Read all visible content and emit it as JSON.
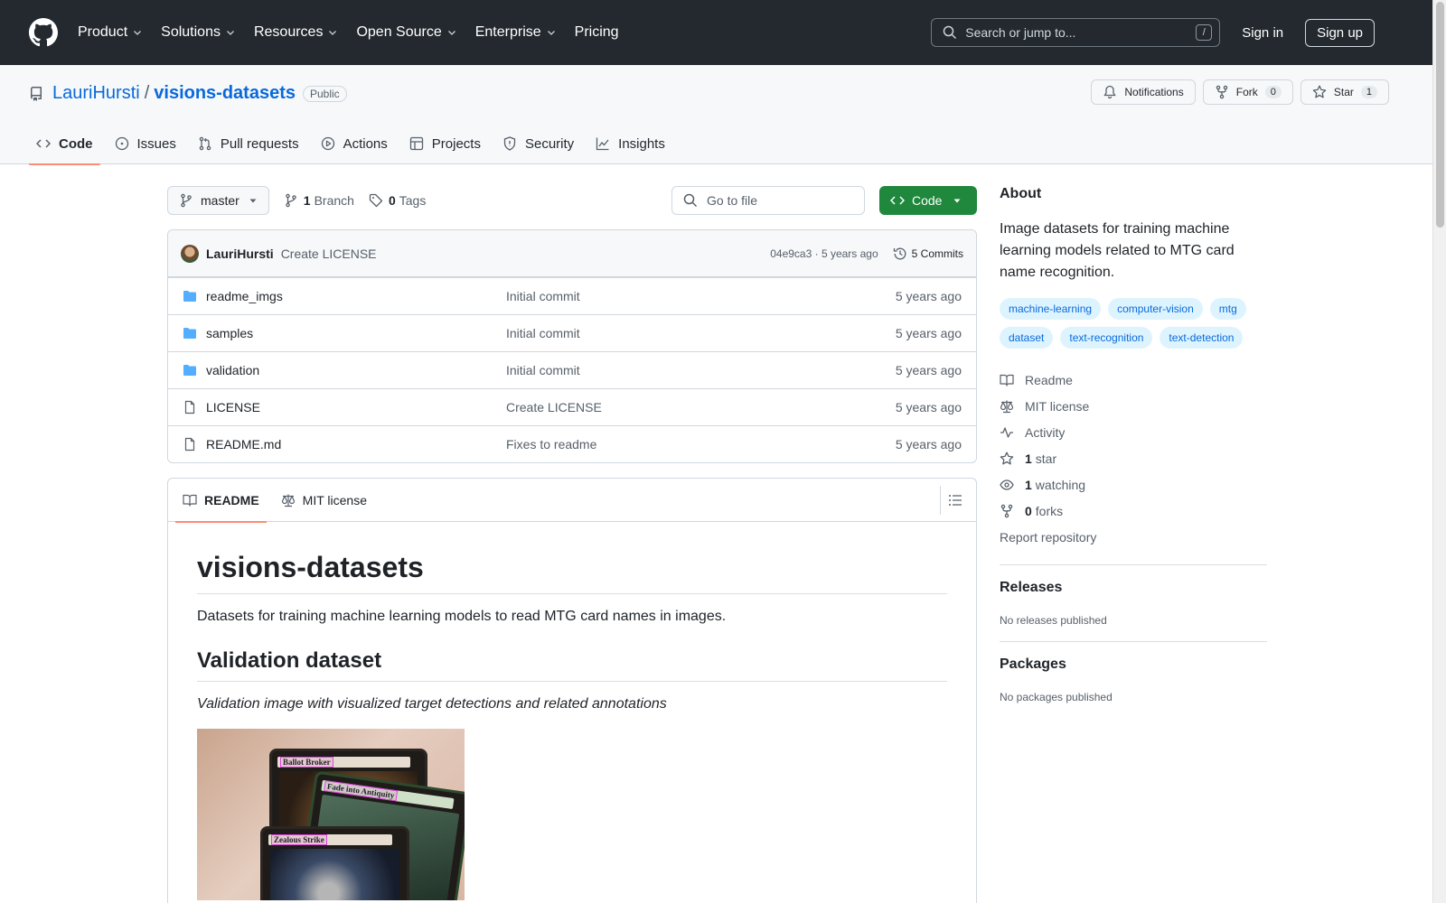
{
  "header": {
    "nav": [
      {
        "label": "Product",
        "dropdown": true
      },
      {
        "label": "Solutions",
        "dropdown": true
      },
      {
        "label": "Resources",
        "dropdown": true
      },
      {
        "label": "Open Source",
        "dropdown": true
      },
      {
        "label": "Enterprise",
        "dropdown": true
      },
      {
        "label": "Pricing",
        "dropdown": false
      }
    ],
    "search_placeholder": "Search or jump to...",
    "search_key": "/",
    "sign_in": "Sign in",
    "sign_up": "Sign up"
  },
  "repo": {
    "owner": "LauriHursti",
    "separator": "/",
    "name": "visions-datasets",
    "visibility": "Public",
    "actions": {
      "notifications": "Notifications",
      "fork": "Fork",
      "fork_count": "0",
      "star": "Star",
      "star_count": "1"
    },
    "tabs": [
      {
        "label": "Code",
        "icon": "code-icon",
        "active": true
      },
      {
        "label": "Issues",
        "icon": "issue-icon"
      },
      {
        "label": "Pull requests",
        "icon": "pull-request-icon"
      },
      {
        "label": "Actions",
        "icon": "play-icon"
      },
      {
        "label": "Projects",
        "icon": "table-icon"
      },
      {
        "label": "Security",
        "icon": "shield-icon"
      },
      {
        "label": "Insights",
        "icon": "graph-icon"
      }
    ]
  },
  "toolbar": {
    "branch": "master",
    "branch_count": "1",
    "branch_label": "Branch",
    "tag_count": "0",
    "tag_label": "Tags",
    "goto_placeholder": "Go to file",
    "code_button": "Code"
  },
  "commit": {
    "author": "LauriHursti",
    "message": "Create LICENSE",
    "meta": "04e9ca3 · 5 years ago",
    "commits": "5 Commits"
  },
  "files": [
    {
      "name": "readme_imgs",
      "type": "folder",
      "message": "Initial commit",
      "date": "5 years ago"
    },
    {
      "name": "samples",
      "type": "folder",
      "message": "Initial commit",
      "date": "5 years ago"
    },
    {
      "name": "validation",
      "type": "folder",
      "message": "Initial commit",
      "date": "5 years ago"
    },
    {
      "name": "LICENSE",
      "type": "file",
      "message": "Create LICENSE",
      "date": "5 years ago"
    },
    {
      "name": "README.md",
      "type": "file",
      "message": "Fixes to readme",
      "date": "5 years ago"
    }
  ],
  "readme": {
    "tabs": [
      "README",
      "MIT license"
    ],
    "title": "visions-datasets",
    "intro": "Datasets for training machine learning models to read MTG card names in images.",
    "h2": "Validation dataset",
    "caption": "Validation image with visualized target detections and related annotations",
    "card_titles": [
      "Ballot Broker",
      "Fade into Antiquity",
      "Zealous Strike"
    ]
  },
  "about": {
    "heading": "About",
    "description": "Image datasets for training machine learning models related to MTG card name recognition.",
    "topics": [
      "machine-learning",
      "computer-vision",
      "mtg",
      "dataset",
      "text-recognition",
      "text-detection"
    ],
    "links": [
      {
        "icon": "book-icon",
        "label": "Readme"
      },
      {
        "icon": "scale-icon",
        "label": "MIT license"
      },
      {
        "icon": "pulse-icon",
        "label": "Activity"
      },
      {
        "icon": "star-icon",
        "count": "1",
        "label": "star"
      },
      {
        "icon": "eye-icon",
        "count": "1",
        "label": "watching"
      },
      {
        "icon": "fork-icon",
        "count": "0",
        "label": "forks"
      }
    ],
    "report": "Report repository"
  },
  "releases": {
    "heading": "Releases",
    "empty": "No releases published"
  },
  "packages": {
    "heading": "Packages",
    "empty": "No packages published"
  },
  "colors": {
    "header_bg": "#24292f",
    "link": "#0969da",
    "code_button": "#1f883d",
    "active_tab": "#fd8c73",
    "folder": "#54aeff"
  }
}
